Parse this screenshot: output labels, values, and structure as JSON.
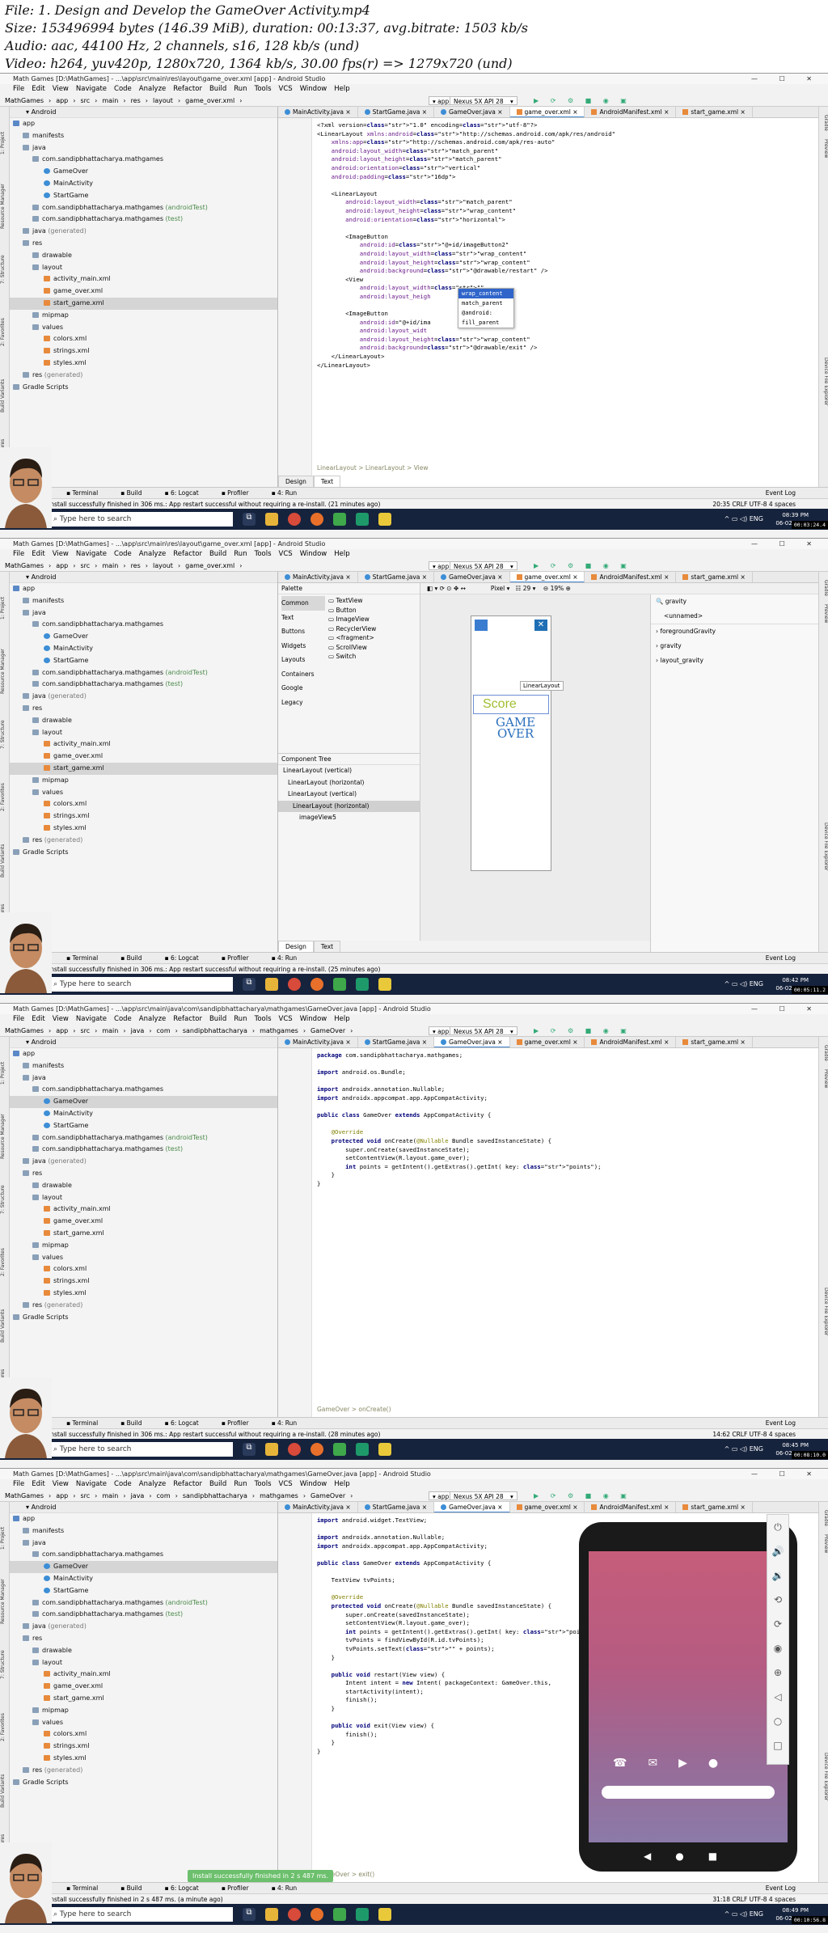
{
  "header": {
    "file": "File: 1. Design and Develop the GameOver Activity.mp4",
    "size": "Size: 153496994 bytes (146.39 MiB), duration: 00:13:37, avg.bitrate: 1503 kb/s",
    "audio": "Audio: aac, 44100 Hz, 2 channels, s16, 128 kb/s (und)",
    "video": "Video: h264, yuv420p, 1280x720, 1364 kb/s, 30.00 fps(r) => 1279x720 (und)"
  },
  "common": {
    "menu": [
      "File",
      "Edit",
      "View",
      "Navigate",
      "Code",
      "Analyze",
      "Refactor",
      "Build",
      "Run",
      "Tools",
      "VCS",
      "Window",
      "Help"
    ],
    "run_config": "app",
    "device": "Nexus 5X API 28",
    "project_header": "Android",
    "bottom_tools": [
      "Terminal",
      "Build",
      "6: Logcat",
      "Profiler",
      "4: Run"
    ],
    "event_log": "Event Log",
    "search_placeholder": "Type here to search",
    "left_tools": [
      "1: Project",
      "Resource Manager",
      "7: Structure",
      "2: Favorites",
      "Build Variants",
      "Layout Captures"
    ],
    "right_tools": [
      "Gradle",
      "Preview",
      "Device File Explorer"
    ],
    "tray_lang": "ENG"
  },
  "frames": [
    {
      "title": "Math Games [D:\\MathGames] - ...\\app\\src\\main\\res\\layout\\game_over.xml [app] - Android Studio",
      "nav": [
        "MathGames",
        "app",
        "src",
        "main",
        "res",
        "layout",
        "game_over.xml"
      ],
      "tabs": [
        "MainActivity.java",
        "StartGame.java",
        "GameOver.java",
        "game_over.xml",
        "AndroidManifest.xml",
        "start_game.xml"
      ],
      "active_tab": 3,
      "status": "Install successfully finished in 306 ms.: App restart successful without requiring a re-install. (21 minutes ago)",
      "status_right": "20:35  CRLF  UTF-8  4 spaces",
      "clock_time": "08:39 PM",
      "clock_date": "06-02-2020",
      "stamp": "00:03:24.4",
      "edit_tabs": [
        "Design",
        "Text"
      ],
      "crumb": "LinearLayout  >  LinearLayout  >  View",
      "code": [
        "<?xml version=\"1.0\" encoding=\"utf-8\"?>",
        "<LinearLayout xmlns:android=\"http://schemas.android.com/apk/res/android\"",
        "    xmlns:app=\"http://schemas.android.com/apk/res-auto\"",
        "    android:layout_width=\"match_parent\"",
        "    android:layout_height=\"match_parent\"",
        "    android:orientation=\"vertical\"",
        "    android:padding=\"16dp\">",
        "",
        "    <LinearLayout",
        "        android:layout_width=\"match_parent\"",
        "        android:layout_height=\"wrap_content\"",
        "        android:orientation=\"horizontal\">",
        "",
        "        <ImageButton",
        "            android:id=\"@+id/imageButton2\"",
        "            android:layout_width=\"wrap_content\"",
        "            android:layout_height=\"wrap_content\"",
        "            android:background=\"@drawable/restart\" />",
        "        <View",
        "            android:layout_width=\"\"",
        "            android:layout_heigh",
        "",
        "        <ImageButton",
        "            android:id=\"@+id/ima",
        "            android:layout_widt",
        "            android:layout_height=\"wrap_content\"",
        "            android:background=\"@drawable/exit\" />",
        "    </LinearLayout>",
        "</LinearLayout>"
      ],
      "autocomplete": [
        "wrap_content",
        "match_parent",
        "@android:",
        "fill_parent"
      ]
    },
    {
      "title": "Math Games [D:\\MathGames] - ...\\app\\src\\main\\res\\layout\\game_over.xml [app] - Android Studio",
      "nav": [
        "MathGames",
        "app",
        "src",
        "main",
        "res",
        "layout",
        "game_over.xml"
      ],
      "tabs": [
        "MainActivity.java",
        "StartGame.java",
        "GameOver.java",
        "game_over.xml",
        "AndroidManifest.xml",
        "start_game.xml"
      ],
      "active_tab": 3,
      "status": "Install successfully finished in 306 ms.: App restart successful without requiring a re-install. (25 minutes ago)",
      "clock_time": "08:42 PM",
      "clock_date": "06-02-2020",
      "stamp": "00:05:11.2",
      "edit_tabs": [
        "Design",
        "Text"
      ],
      "palette_title": "Palette",
      "palette_cats": [
        "Common",
        "Text",
        "Buttons",
        "Widgets",
        "Layouts",
        "Containers",
        "Google",
        "Legacy"
      ],
      "palette_items": [
        "TextView",
        "Button",
        "ImageView",
        "RecyclerView",
        "<fragment>",
        "ScrollView",
        "Switch"
      ],
      "design_bar": [
        "Pixel",
        "29",
        "19%"
      ],
      "attr_search": "gravity",
      "attr_unnamed": "<unnamed>",
      "attrs": [
        "foregroundGravity",
        "gravity",
        "layout_gravity"
      ],
      "ctree_title": "Component Tree",
      "ctree": [
        "LinearLayout (vertical)",
        "LinearLayout (horizontal)",
        "LinearLayout (vertical)",
        "LinearLayout (horizontal)",
        "imageView5"
      ],
      "score_text": "Score",
      "gameover_line1": "GAME",
      "gameover_line2": "OVER",
      "tooltip": "LinearLayout"
    },
    {
      "title": "Math Games [D:\\MathGames] - ...\\app\\src\\main\\java\\com\\sandipbhattacharya\\mathgames\\GameOver.java [app] - Android Studio",
      "nav": [
        "MathGames",
        "app",
        "src",
        "main",
        "java",
        "com",
        "sandipbhattacharya",
        "mathgames",
        "GameOver"
      ],
      "tabs": [
        "MainActivity.java",
        "StartGame.java",
        "GameOver.java",
        "game_over.xml",
        "AndroidManifest.xml",
        "start_game.xml"
      ],
      "active_tab": 2,
      "status": "Install successfully finished in 306 ms.: App restart successful without requiring a re-install. (28 minutes ago)",
      "status_right": "14:62  CRLF  UTF-8  4 spaces",
      "clock_time": "08:45 PM",
      "clock_date": "06-02-2020",
      "stamp": "00:08:10.0",
      "crumb": "GameOver  >  onCreate()",
      "code": [
        "package com.sandipbhattacharya.mathgames;",
        "",
        "import android.os.Bundle;",
        "",
        "import androidx.annotation.Nullable;",
        "import androidx.appcompat.app.AppCompatActivity;",
        "",
        "public class GameOver extends AppCompatActivity {",
        "",
        "    @Override",
        "    protected void onCreate(@Nullable Bundle savedInstanceState) {",
        "        super.onCreate(savedInstanceState);",
        "        setContentView(R.layout.game_over);",
        "        int points = getIntent().getExtras().getInt( key: \"points\");",
        "    }",
        "}"
      ]
    },
    {
      "title": "Math Games [D:\\MathGames] - ...\\app\\src\\main\\java\\com\\sandipbhattacharya\\mathgames\\GameOver.java [app] - Android Studio",
      "nav": [
        "MathGames",
        "app",
        "src",
        "main",
        "java",
        "com",
        "sandipbhattacharya",
        "mathgames",
        "GameOver"
      ],
      "tabs": [
        "MainActivity.java",
        "StartGame.java",
        "GameOver.java",
        "game_over.xml",
        "AndroidManifest.xml",
        "start_game.xml"
      ],
      "active_tab": 2,
      "status": "Install successfully finished in 2 s 487 ms. (a minute ago)",
      "status_right": "31:18  CRLF  UTF-8  4 spaces",
      "clock_time": "08:49 PM",
      "clock_date": "06-02-2020",
      "stamp": "00:10:56.8",
      "crumb": "GameOver  >  exit()",
      "toast": "Install successfully finished in 2 s 487 ms.",
      "code": [
        "import android.widget.TextView;",
        "",
        "import androidx.annotation.Nullable;",
        "import androidx.appcompat.app.AppCompatActivity;",
        "",
        "public class GameOver extends AppCompatActivity {",
        "",
        "    TextView tvPoints;",
        "",
        "    @Override",
        "    protected void onCreate(@Nullable Bundle savedInstanceState) {",
        "        super.onCreate(savedInstanceState);",
        "        setContentView(R.layout.game_over);",
        "        int points = getIntent().getExtras().getInt( key: \"points\");",
        "        tvPoints = findViewById(R.id.tvPoints);",
        "        tvPoints.setText(\"\" + points);",
        "    }",
        "",
        "    public void restart(View view) {",
        "        Intent intent = new Intent( packageContext: GameOver.this,",
        "        startActivity(intent);",
        "        finish();",
        "    }",
        "",
        "    public void exit(View view) {",
        "        finish();",
        "    }",
        "}"
      ]
    }
  ],
  "tree": {
    "app": "app",
    "manifests": "manifests",
    "java": "java",
    "pkg": "com.sandipbhattacharya.mathgames",
    "classes": [
      "GameOver",
      "MainActivity",
      "StartGame"
    ],
    "pkg_test": "com.sandipbhattacharya.mathgames",
    "test_android": "(androidTest)",
    "test_unit": "(test)",
    "java_gen": "java",
    "generated": "(generated)",
    "res": "res",
    "drawable": "drawable",
    "layout": "layout",
    "layouts": [
      "activity_main.xml",
      "game_over.xml",
      "start_game.xml"
    ],
    "mipmap": "mipmap",
    "values": "values",
    "value_files": [
      "colors.xml",
      "strings.xml",
      "styles.xml"
    ],
    "res_gen": "res",
    "gradle": "Gradle Scripts"
  }
}
